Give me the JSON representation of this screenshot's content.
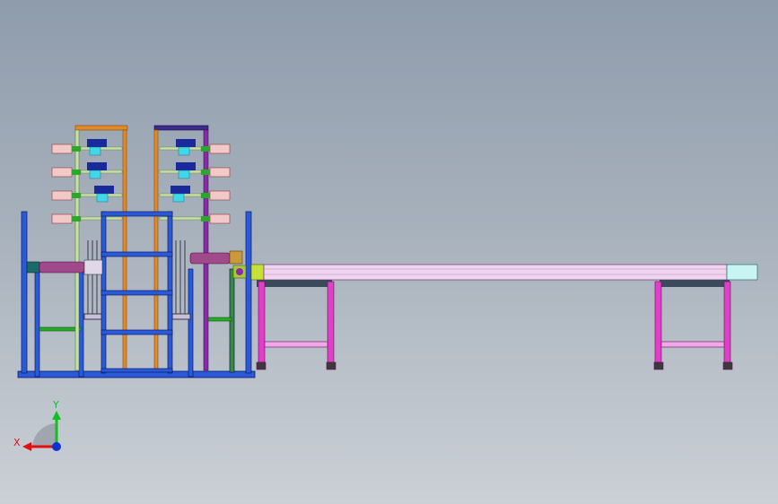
{
  "view": {
    "background_top": "#8f9cac",
    "background_bottom": "#cbd0d6"
  },
  "triad": {
    "x_label": "X",
    "y_label": "Y",
    "x_color": "#e01010",
    "y_color": "#10c020",
    "origin_color": "#1030d0"
  },
  "model": {
    "frame_blue": "#2a5ad8",
    "frame_orange": "#e08a2a",
    "frame_purple": "#8a2aa8",
    "table_magenta": "#e040c8",
    "rail_lavender": "#f0d4f0",
    "tube_pink": "#f2c8c8",
    "roller_purple": "#a04a8a",
    "green_bar": "#2aa82a",
    "cyan_block": "#40d8e8",
    "dark_blue": "#1a2a9a"
  }
}
